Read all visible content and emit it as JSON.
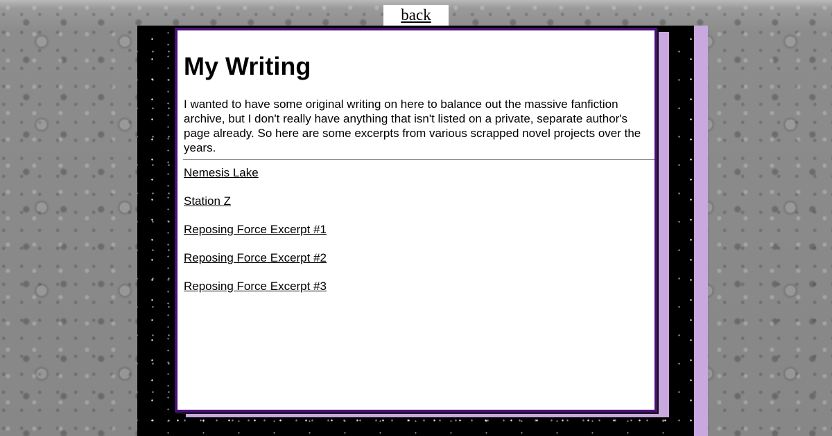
{
  "nav": {
    "back_label": "back"
  },
  "page": {
    "title": "My Writing",
    "intro": "I wanted to have some original writing on here to balance out the massive fanfiction archive, but I don't really have anything that isn't listed on a private, separate author's page already. So here are some excerpts from various scrapped novel projects over the years."
  },
  "links": [
    {
      "label": "Nemesis Lake"
    },
    {
      "label": "Station Z"
    },
    {
      "label": "Reposing Force Excerpt #1"
    },
    {
      "label": "Reposing Force Excerpt #2"
    },
    {
      "label": "Reposing Force Excerpt #3"
    }
  ],
  "colors": {
    "card_border": "#4b0f79",
    "accent_lavender": "#c8a8de",
    "space_bg": "#000000",
    "card_bg": "#ffffff"
  }
}
